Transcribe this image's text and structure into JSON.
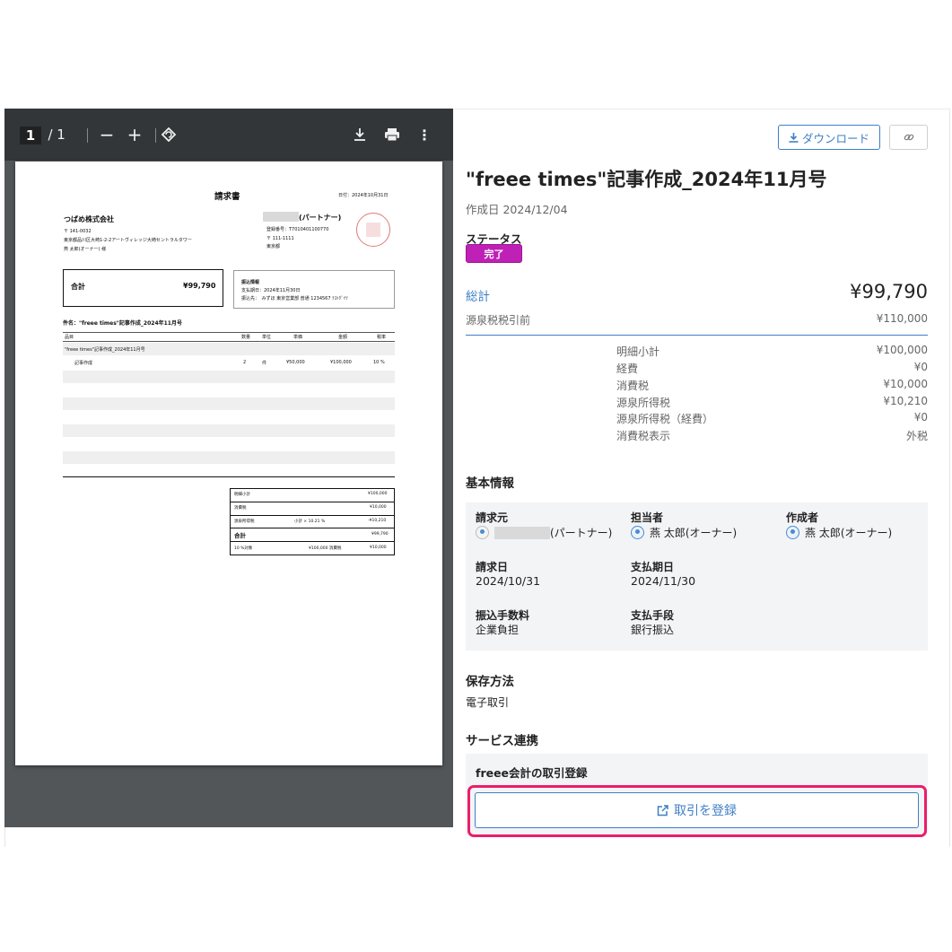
{
  "viewer": {
    "page_current": "1",
    "page_separator": "/",
    "page_total": "1",
    "zoom_out": "−",
    "zoom_in": "+",
    "rotate": "⟲",
    "download": "⤓",
    "print": "🖶",
    "more": "⋮"
  },
  "invoice": {
    "title": "請求書",
    "date": "日付：2024年10月31日",
    "client_name": "つばめ株式会社",
    "client_zip": "〒 141-0032",
    "client_address": "東京都品川区大崎1-2-2アートヴィレッジ大崎セントラルタワー",
    "client_contact": "燕 太郎(オーナー) 様",
    "partner_suffix": "(パートナー)",
    "partner_reg": "登録番号：T7010401100770",
    "partner_zip": "〒 111-1111",
    "partner_city": "東京都",
    "total_label": "合計",
    "total_value": "¥99,790",
    "pay_info_title": "振込情報",
    "pay_due": "支払期日：2024年11月30日",
    "pay_dest": "振込先：　みずほ 東京営業部 普通 1234567 ﾃｽﾄｸﾞｲﾂ",
    "subject": "件名：\"freee times\"記事作成_2024年11月号",
    "columns": [
      "品目",
      "数量",
      "単位",
      "単価",
      "金額",
      "税率"
    ],
    "group_row": "\"freee times\"記事作成_2024年11月号",
    "item": {
      "name": "記事作成",
      "qty": "2",
      "unit": "件",
      "price": "¥50,000",
      "amount": "¥100,000",
      "rate": "10 %"
    },
    "summary": {
      "subtotal_label": "明細小計",
      "subtotal": "¥100,000",
      "tax_label": "消費税",
      "tax": "¥10,000",
      "withholding_label": "源泉所得税",
      "withholding_note": "小計 × 10.21 %",
      "withholding": "-¥10,210",
      "total_label": "合計",
      "total": "¥99,790",
      "rate_label": "10 %対象",
      "rate_note": "¥100,000 消費税",
      "rate_tax": "¥10,000"
    }
  },
  "panel": {
    "download_label": "ダウンロード",
    "link_icon": "link-icon",
    "title": "\"freee times\"記事作成_2024年11月号",
    "created": "作成日 2024/12/04",
    "status_label": "ステータス",
    "status_value": "完了",
    "total_label": "総計",
    "total_value": "¥99,790",
    "pre_withholding_label": "源泉税税引前",
    "pre_withholding_value": "¥110,000",
    "breakdown": [
      {
        "label": "明細小計",
        "value": "¥100,000"
      },
      {
        "label": "経費",
        "value": "¥0"
      },
      {
        "label": "消費税",
        "value": "¥10,000"
      },
      {
        "label": "源泉所得税",
        "value": "¥10,210"
      },
      {
        "label": "源泉所得税（経費）",
        "value": "¥0"
      },
      {
        "label": "消費税表示",
        "value": "外税"
      }
    ],
    "basic_info_heading": "基本情報",
    "requester_label": "請求元",
    "requester_suffix": "(パートナー)",
    "assignee_label": "担当者",
    "assignee_value": "燕 太郎(オーナー)",
    "creator_label": "作成者",
    "creator_value": "燕 太郎(オーナー)",
    "invoice_date_label": "請求日",
    "invoice_date": "2024/10/31",
    "due_date_label": "支払期日",
    "due_date": "2024/11/30",
    "fee_label": "振込手数料",
    "fee_value": "企業負担",
    "method_label": "支払手段",
    "method_value": "銀行振込",
    "storage_heading": "保存方法",
    "storage_value": "電子取引",
    "service_heading": "サービス連携",
    "service_subheading": "freee会計の取引登録",
    "register_button": "取引を登録"
  },
  "colors": {
    "accent": "#3d7fc6",
    "status": "#bf21b6",
    "highlight": "#ea1e6a"
  }
}
